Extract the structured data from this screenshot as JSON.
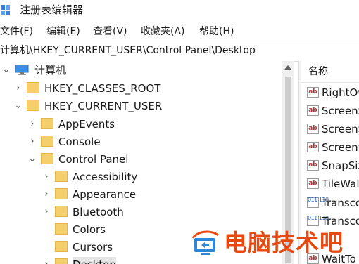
{
  "window": {
    "title": "注册表编辑器"
  },
  "menu": [
    {
      "label": "文件(F)"
    },
    {
      "label": "编辑(E)"
    },
    {
      "label": "查看(V)"
    },
    {
      "label": "收藏夹(A)"
    },
    {
      "label": "帮助(H)"
    }
  ],
  "address": {
    "path": "计算机\\HKEY_CURRENT_USER\\Control Panel\\Desktop"
  },
  "tree": {
    "root": "计算机",
    "items": [
      {
        "label": "HKEY_CLASSES_ROOT",
        "expander": "›"
      },
      {
        "label": "HKEY_CURRENT_USER",
        "expander": "⌄"
      },
      {
        "label": "AppEvents",
        "expander": "›"
      },
      {
        "label": "Console",
        "expander": "›"
      },
      {
        "label": "Control Panel",
        "expander": "⌄"
      },
      {
        "label": "Accessibility",
        "expander": "›"
      },
      {
        "label": "Appearance",
        "expander": "›"
      },
      {
        "label": "Bluetooth",
        "expander": "›"
      },
      {
        "label": "Colors",
        "expander": ""
      },
      {
        "label": "Cursors",
        "expander": ""
      },
      {
        "label": "Desktop",
        "expander": "›"
      }
    ]
  },
  "list": {
    "column_name": "名称",
    "values": [
      {
        "name": "RightOv",
        "type": "string",
        "type_glyph": "ab"
      },
      {
        "name": "ScreenS",
        "type": "string",
        "type_glyph": "ab"
      },
      {
        "name": "ScreenS",
        "type": "string",
        "type_glyph": "ab"
      },
      {
        "name": "ScreenS",
        "type": "string",
        "type_glyph": "ab"
      },
      {
        "name": "SnapSiz",
        "type": "string",
        "type_glyph": "ab"
      },
      {
        "name": "TileWal",
        "type": "string",
        "type_glyph": "ab"
      },
      {
        "name": "Transco",
        "type": "binary",
        "type_glyph": "011 110"
      },
      {
        "name": "Transco",
        "type": "binary",
        "type_glyph": "011 110"
      },
      {
        "name": "WaitTo",
        "type": "string",
        "type_glyph": "ab"
      }
    ]
  },
  "watermark": {
    "text": "电脑技术吧",
    "color": "#e64a11",
    "icon": "computer-logo-icon"
  },
  "colors": {
    "folder": "#f5cf6b",
    "selection": "#e5e5e5",
    "accent": "#2b5fbf"
  }
}
